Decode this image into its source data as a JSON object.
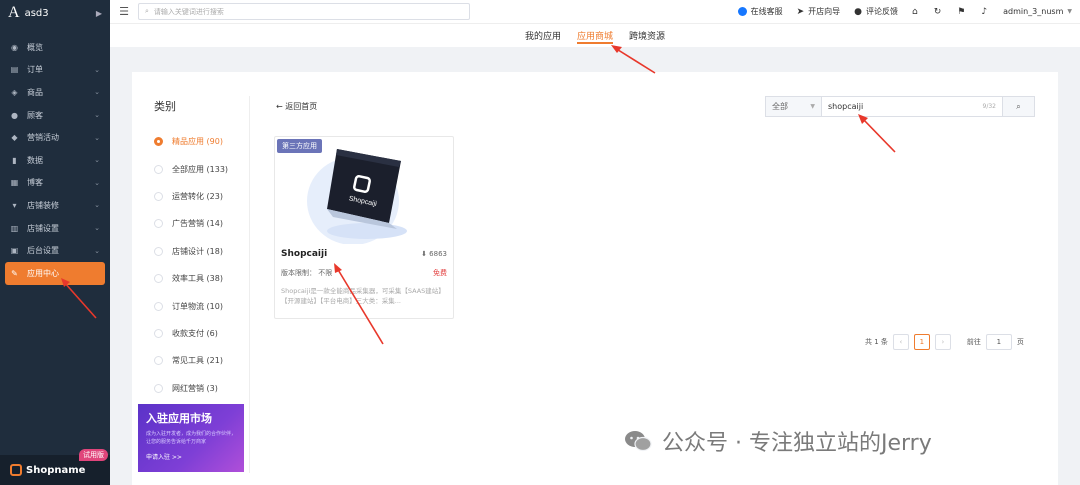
{
  "app": {
    "store_name": "asd3",
    "shopname": "Shopname",
    "trial": "试用版"
  },
  "sidebar": {
    "items": [
      {
        "label": "概览",
        "icon": "dashboard-icon",
        "arrow": false
      },
      {
        "label": "订单",
        "icon": "order-icon",
        "arrow": true
      },
      {
        "label": "商品",
        "icon": "product-icon",
        "arrow": true
      },
      {
        "label": "顾客",
        "icon": "customer-icon",
        "arrow": true
      },
      {
        "label": "营销活动",
        "icon": "tag-icon",
        "arrow": true
      },
      {
        "label": "数据",
        "icon": "chart-icon",
        "arrow": true
      },
      {
        "label": "博客",
        "icon": "blog-icon",
        "arrow": true
      },
      {
        "label": "店铺装修",
        "icon": "brush-icon",
        "arrow": true
      },
      {
        "label": "店铺设置",
        "icon": "store-settings-icon",
        "arrow": true
      },
      {
        "label": "后台设置",
        "icon": "admin-settings-icon",
        "arrow": true
      },
      {
        "label": "应用中心",
        "icon": "wrench-icon",
        "arrow": false,
        "active": true
      }
    ]
  },
  "topbar": {
    "search_placeholder": "请输入关键词进行搜索",
    "online_service": "在线客服",
    "guide": "开店向导",
    "feedback": "评论反馈",
    "user": "admin_3_nusm"
  },
  "tabs": [
    {
      "label": "我的应用"
    },
    {
      "label": "应用商城",
      "active": true
    },
    {
      "label": "跨境资源"
    }
  ],
  "categories": {
    "title": "类别",
    "items": [
      {
        "label": "精品应用 (90)",
        "selected": true
      },
      {
        "label": "全部应用 (133)"
      },
      {
        "label": "运营转化 (23)"
      },
      {
        "label": "广告营销 (14)"
      },
      {
        "label": "店铺设计 (18)"
      },
      {
        "label": "效率工具 (38)"
      },
      {
        "label": "订单物流 (10)"
      },
      {
        "label": "收款支付 (6)"
      },
      {
        "label": "常见工具 (21)"
      },
      {
        "label": "网红营销 (3)"
      }
    ]
  },
  "banner": {
    "title": "入驻应用市场",
    "subtitle": "成为入驻开发者，成为我们的合作伙伴，让您的服务告诉给千万商家",
    "cta": "申请入驻 >>"
  },
  "main": {
    "back_label": "返回首页",
    "search": {
      "scope": "全部",
      "value": "shopcaiji",
      "counter": "9/32"
    },
    "app_card": {
      "badge": "第三方应用",
      "name": "Shopcaiji",
      "downloads": "6863",
      "limit": "版本限制： 不限",
      "price": "免费",
      "description": "Shopcaiji是一款全能商品采集器，可采集【SAAS建站】【开源建站】【平台电商】三大类：采集..."
    },
    "pagination": {
      "total": "共 1 条",
      "current": "1",
      "goto_prefix": "前往",
      "goto_value": "1",
      "goto_suffix": "页"
    }
  },
  "watermark": "公众号 · 专注独立站的Jerry",
  "colors": {
    "accent": "#ef7c2f",
    "sidebar": "#1f2d3d",
    "badge": "#6b74b8",
    "free": "#e23b3b",
    "arrow": "#e8382b"
  }
}
